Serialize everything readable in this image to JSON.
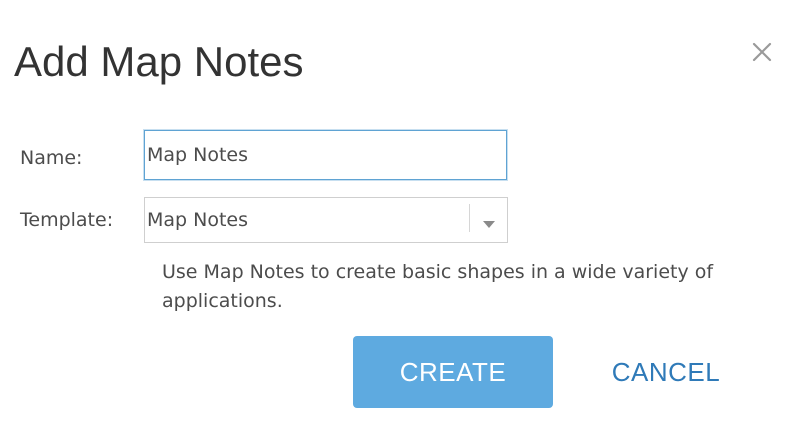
{
  "dialog": {
    "title": "Add Map Notes",
    "close_icon": "close-icon"
  },
  "form": {
    "name_label": "Name:",
    "name_value": "Map Notes",
    "template_label": "Template:",
    "template_selected": "Map Notes",
    "template_dropdown_icon": "chevron-down-icon",
    "help_text": "Use Map Notes to create basic shapes in a wide variety of applications."
  },
  "actions": {
    "create_label": "CREATE",
    "cancel_label": "CANCEL"
  },
  "colors": {
    "primary_button": "#5eaae0",
    "link_text": "#2f7ab8",
    "focus_border": "#5fa3d3",
    "text": "#4c4c4c"
  }
}
